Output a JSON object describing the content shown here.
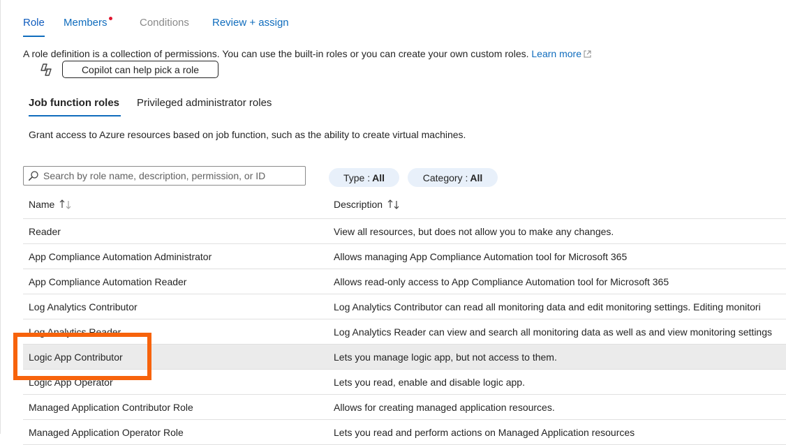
{
  "tabs": [
    {
      "label": "Role",
      "state": "active"
    },
    {
      "label": "Members",
      "state": "link",
      "has_dot": true
    },
    {
      "label": "Conditions",
      "state": "disabled"
    },
    {
      "label": "Review + assign",
      "state": "link"
    }
  ],
  "description": {
    "text": "A role definition is a collection of permissions. You can use the built-in roles or you can create your own custom roles.",
    "learn_more": "Learn more"
  },
  "copilot": {
    "icon": "copilot-icon",
    "button_label": "Copilot can help pick a role"
  },
  "subtabs": [
    {
      "label": "Job function roles",
      "active": true
    },
    {
      "label": "Privileged administrator roles",
      "active": false
    }
  ],
  "grant_text": "Grant access to Azure resources based on job function, such as the ability to create virtual machines.",
  "search": {
    "placeholder": "Search by role name, description, permission, or ID",
    "value": ""
  },
  "filters": {
    "type": {
      "label": "Type :",
      "value": "All"
    },
    "category": {
      "label": "Category :",
      "value": "All"
    }
  },
  "table": {
    "columns": [
      {
        "label": "Name",
        "icon": "sort-icon"
      },
      {
        "label": "Description",
        "icon": "sort-icon"
      }
    ],
    "rows": [
      {
        "name": "Reader",
        "description": "View all resources, but does not allow you to make any changes."
      },
      {
        "name": "App Compliance Automation Administrator",
        "description": "Allows managing App Compliance Automation tool for Microsoft 365"
      },
      {
        "name": "App Compliance Automation Reader",
        "description": "Allows read-only access to App Compliance Automation tool for Microsoft 365"
      },
      {
        "name": "Log Analytics Contributor",
        "description": "Log Analytics Contributor can read all monitoring data and edit monitoring settings. Editing monitori"
      },
      {
        "name": "Log Analytics Reader",
        "description": "Log Analytics Reader can view and search all monitoring data as well as and view monitoring settings"
      },
      {
        "name": "Logic App Contributor",
        "description": "Lets you manage logic app, but not access to them.",
        "selected": true
      },
      {
        "name": "Logic App Operator",
        "description": "Lets you read, enable and disable logic app."
      },
      {
        "name": "Managed Application Contributor Role",
        "description": "Allows for creating managed application resources."
      },
      {
        "name": "Managed Application Operator Role",
        "description": "Lets you read and perform actions on Managed Application resources"
      }
    ]
  },
  "colors": {
    "accent": "#0f6cbd",
    "highlight": "#f7630c",
    "dot": "#e0152f",
    "pill_bg": "#e8f0fa",
    "selected_row": "#ebebeb"
  }
}
